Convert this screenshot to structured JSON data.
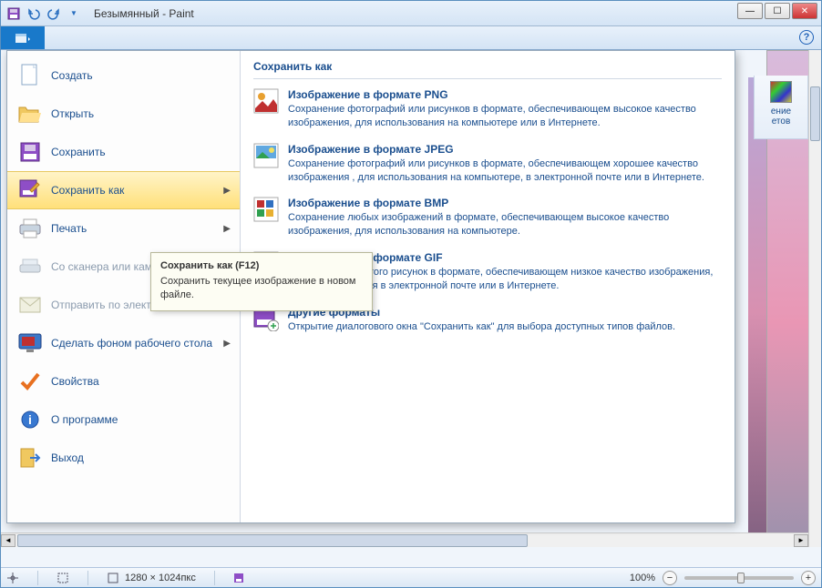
{
  "window": {
    "title": "Безымянный - Paint"
  },
  "ribbon": {
    "edit_colors_line1": "ение",
    "edit_colors_line2": "етов"
  },
  "menu": {
    "left": {
      "create": "Создать",
      "open": "Открыть",
      "save": "Сохранить",
      "save_as": "Сохранить как",
      "print": "Печать",
      "scanner": "Со сканера или камеры",
      "email": "Отправить по электронной почте",
      "desktop_bg": "Сделать фоном рабочего стола",
      "properties": "Свойства",
      "about": "О программе",
      "exit": "Выход"
    },
    "panel_title": "Сохранить как",
    "formats": [
      {
        "title": "Изображение в формате PNG",
        "desc": "Сохранение фотографий или рисунков в формате, обеспечивающем высокое качество изображения, для использования на компьютере или в Интернете."
      },
      {
        "title": "Изображение в формате JPEG",
        "desc": "Сохранение фотографий или рисунков в формате, обеспечивающем хорошее качество изображения , для использования на компьютере, в электронной почте или в Интернете."
      },
      {
        "title": "Изображение в формате BMP",
        "desc": "Сохранение любых изображений в формате, обеспечивающем высокое качество изображения, для использования на компьютере."
      },
      {
        "title": "Изображение в формате GIF",
        "desc": "Сохранение простого рисунок в формате, обеспечивающем низкое качество изображения, для использования в электронной почте или в Интернете."
      },
      {
        "title": "Другие форматы",
        "desc": "Открытие диалогового окна \"Сохранить как\" для выбора доступных типов файлов."
      }
    ]
  },
  "tooltip": {
    "title": "Сохранить как (F12)",
    "body": "Сохранить текущее изображение в новом файле."
  },
  "status": {
    "dimensions": "1280 × 1024пкс",
    "zoom": "100%"
  }
}
